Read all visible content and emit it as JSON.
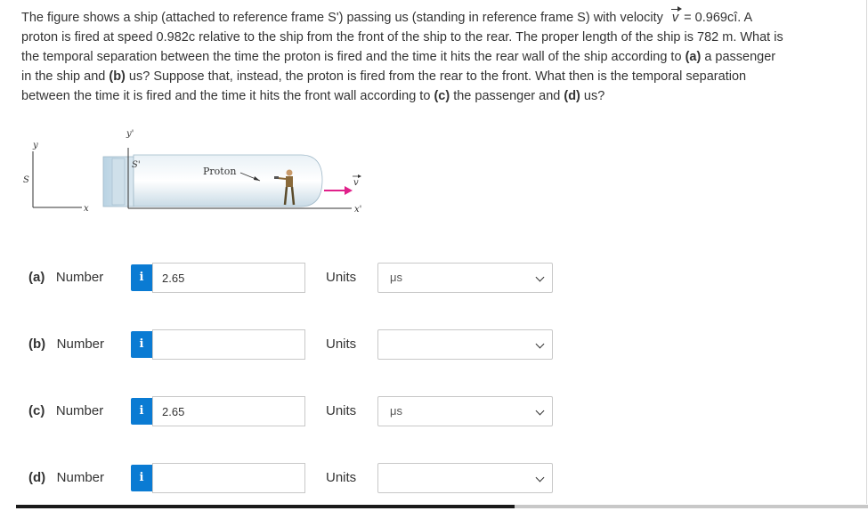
{
  "problem": {
    "line1_a": "The figure shows a ship (attached to reference frame S') passing us (standing in reference frame S) with velocity",
    "vector_symbol": "v",
    "line1_b": "= 0.969cî. A",
    "line2": "proton is fired at speed 0.982c relative to the ship from the front of the ship to the rear. The proper length of the ship is 782 m. What is",
    "line3_a": "the temporal separation between the time the proton is fired and the time it hits the rear wall of the ship according to",
    "part_a": "(a)",
    "line3_b": "a passenger",
    "line4_a": "in the ship and",
    "part_b": "(b)",
    "line4_b": "us? Suppose that, instead, the proton is fired from the rear to the front. What then is the temporal separation",
    "line5_a": "between the time it is fired and the time it hits the front wall according to",
    "part_c": "(c)",
    "line5_b": "the passenger and",
    "part_d": "(d)",
    "line5_c": "us?"
  },
  "figure": {
    "label_y": "y",
    "label_y_prime": "y'",
    "label_s": "S",
    "label_s_prime": "S'",
    "label_x": "x",
    "label_x_prime": "x'",
    "label_proton": "Proton",
    "label_v": "v"
  },
  "rows": [
    {
      "part": "(a)",
      "label": "Number",
      "value": "2.65",
      "units_label": "Units",
      "units_value": "μs",
      "info": "i"
    },
    {
      "part": "(b)",
      "label": "Number",
      "value": "",
      "units_label": "Units",
      "units_value": "",
      "info": "i"
    },
    {
      "part": "(c)",
      "label": "Number",
      "value": "2.65",
      "units_label": "Units",
      "units_value": "μs",
      "info": "i"
    },
    {
      "part": "(d)",
      "label": "Number",
      "value": "",
      "units_label": "Units",
      "units_value": "",
      "info": "i"
    }
  ],
  "colors": {
    "info_button": "#0a7bd3",
    "ship_body": "#d7e5ee",
    "velocity_arrow": "#e0218a"
  }
}
